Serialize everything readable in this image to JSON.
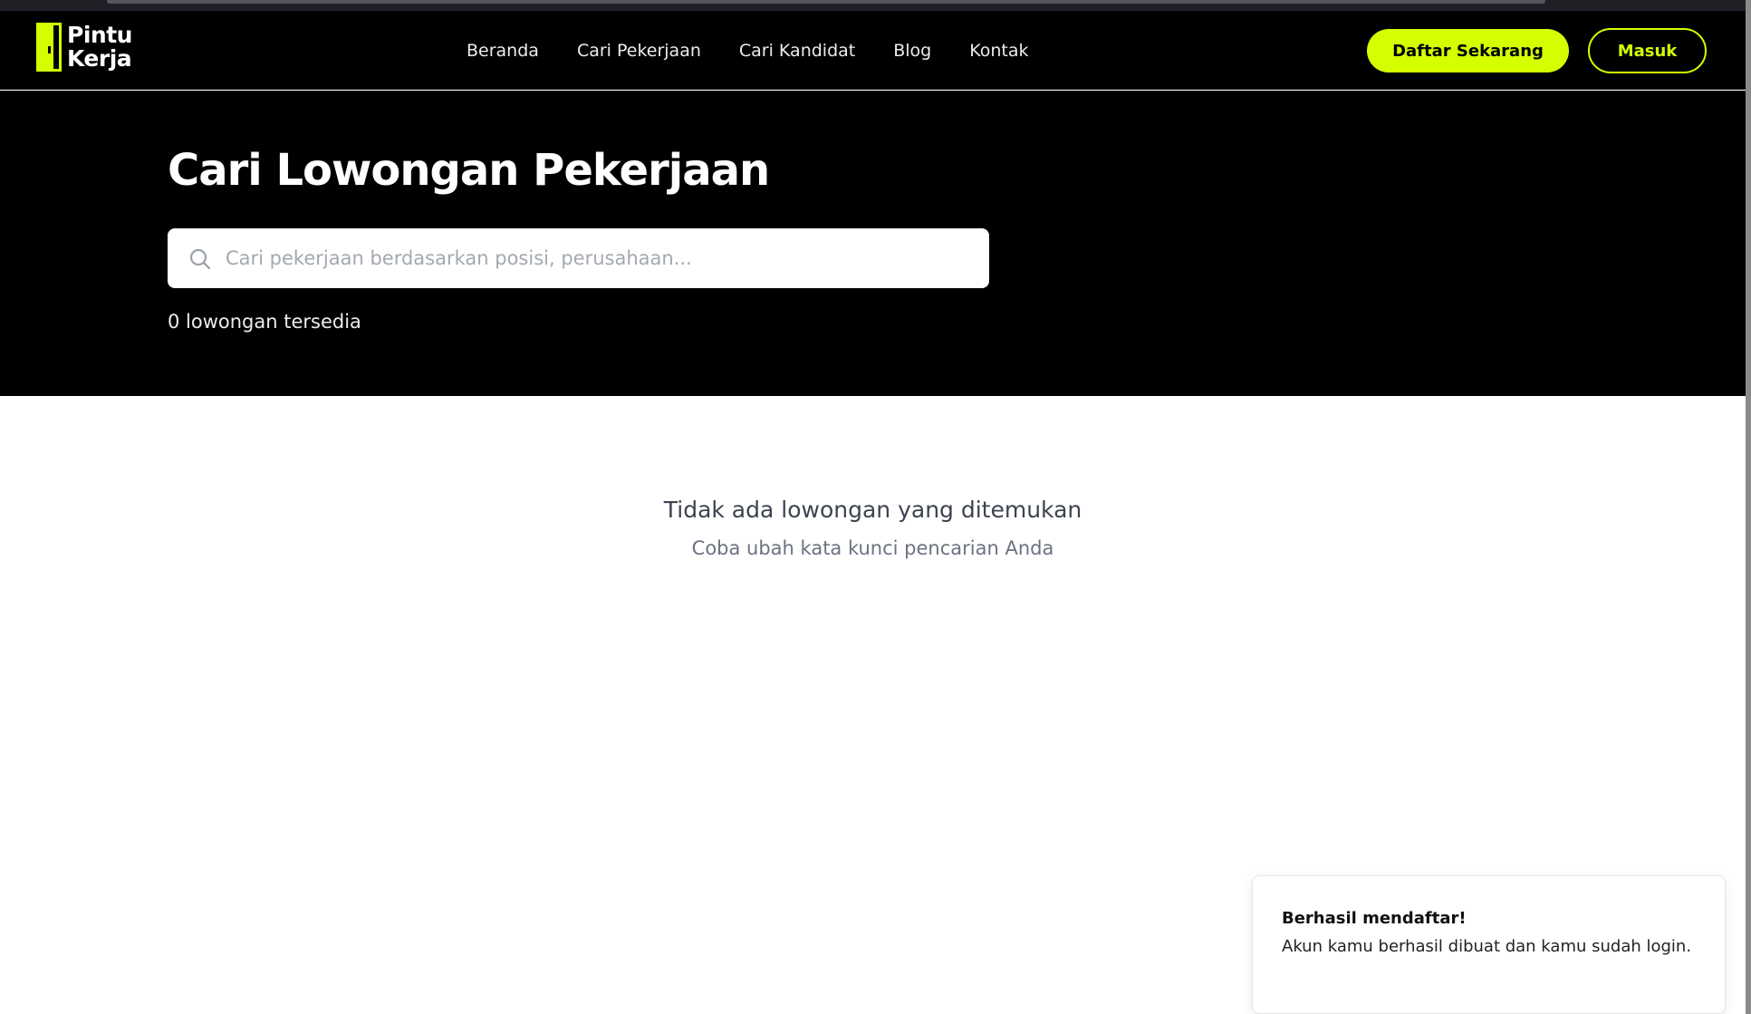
{
  "brand": {
    "name_line1": "Pintu",
    "name_line2": "Kerja",
    "accent_color": "#d4ff00"
  },
  "nav": {
    "items": [
      {
        "label": "Beranda"
      },
      {
        "label": "Cari Pekerjaan"
      },
      {
        "label": "Cari Kandidat"
      },
      {
        "label": "Blog"
      },
      {
        "label": "Kontak"
      }
    ],
    "register_label": "Daftar Sekarang",
    "login_label": "Masuk"
  },
  "hero": {
    "title": "Cari Lowongan Pekerjaan",
    "search": {
      "icon": "search-icon",
      "value": "",
      "placeholder": "Cari pekerjaan berdasarkan posisi, perusahaan..."
    },
    "count_text": "0 lowongan tersedia"
  },
  "results": {
    "empty_title": "Tidak ada lowongan yang ditemukan",
    "empty_subtitle": "Coba ubah kata kunci pencarian Anda"
  },
  "toast": {
    "title": "Berhasil mendaftar!",
    "message": "Akun kamu berhasil dibuat dan kamu sudah login."
  }
}
